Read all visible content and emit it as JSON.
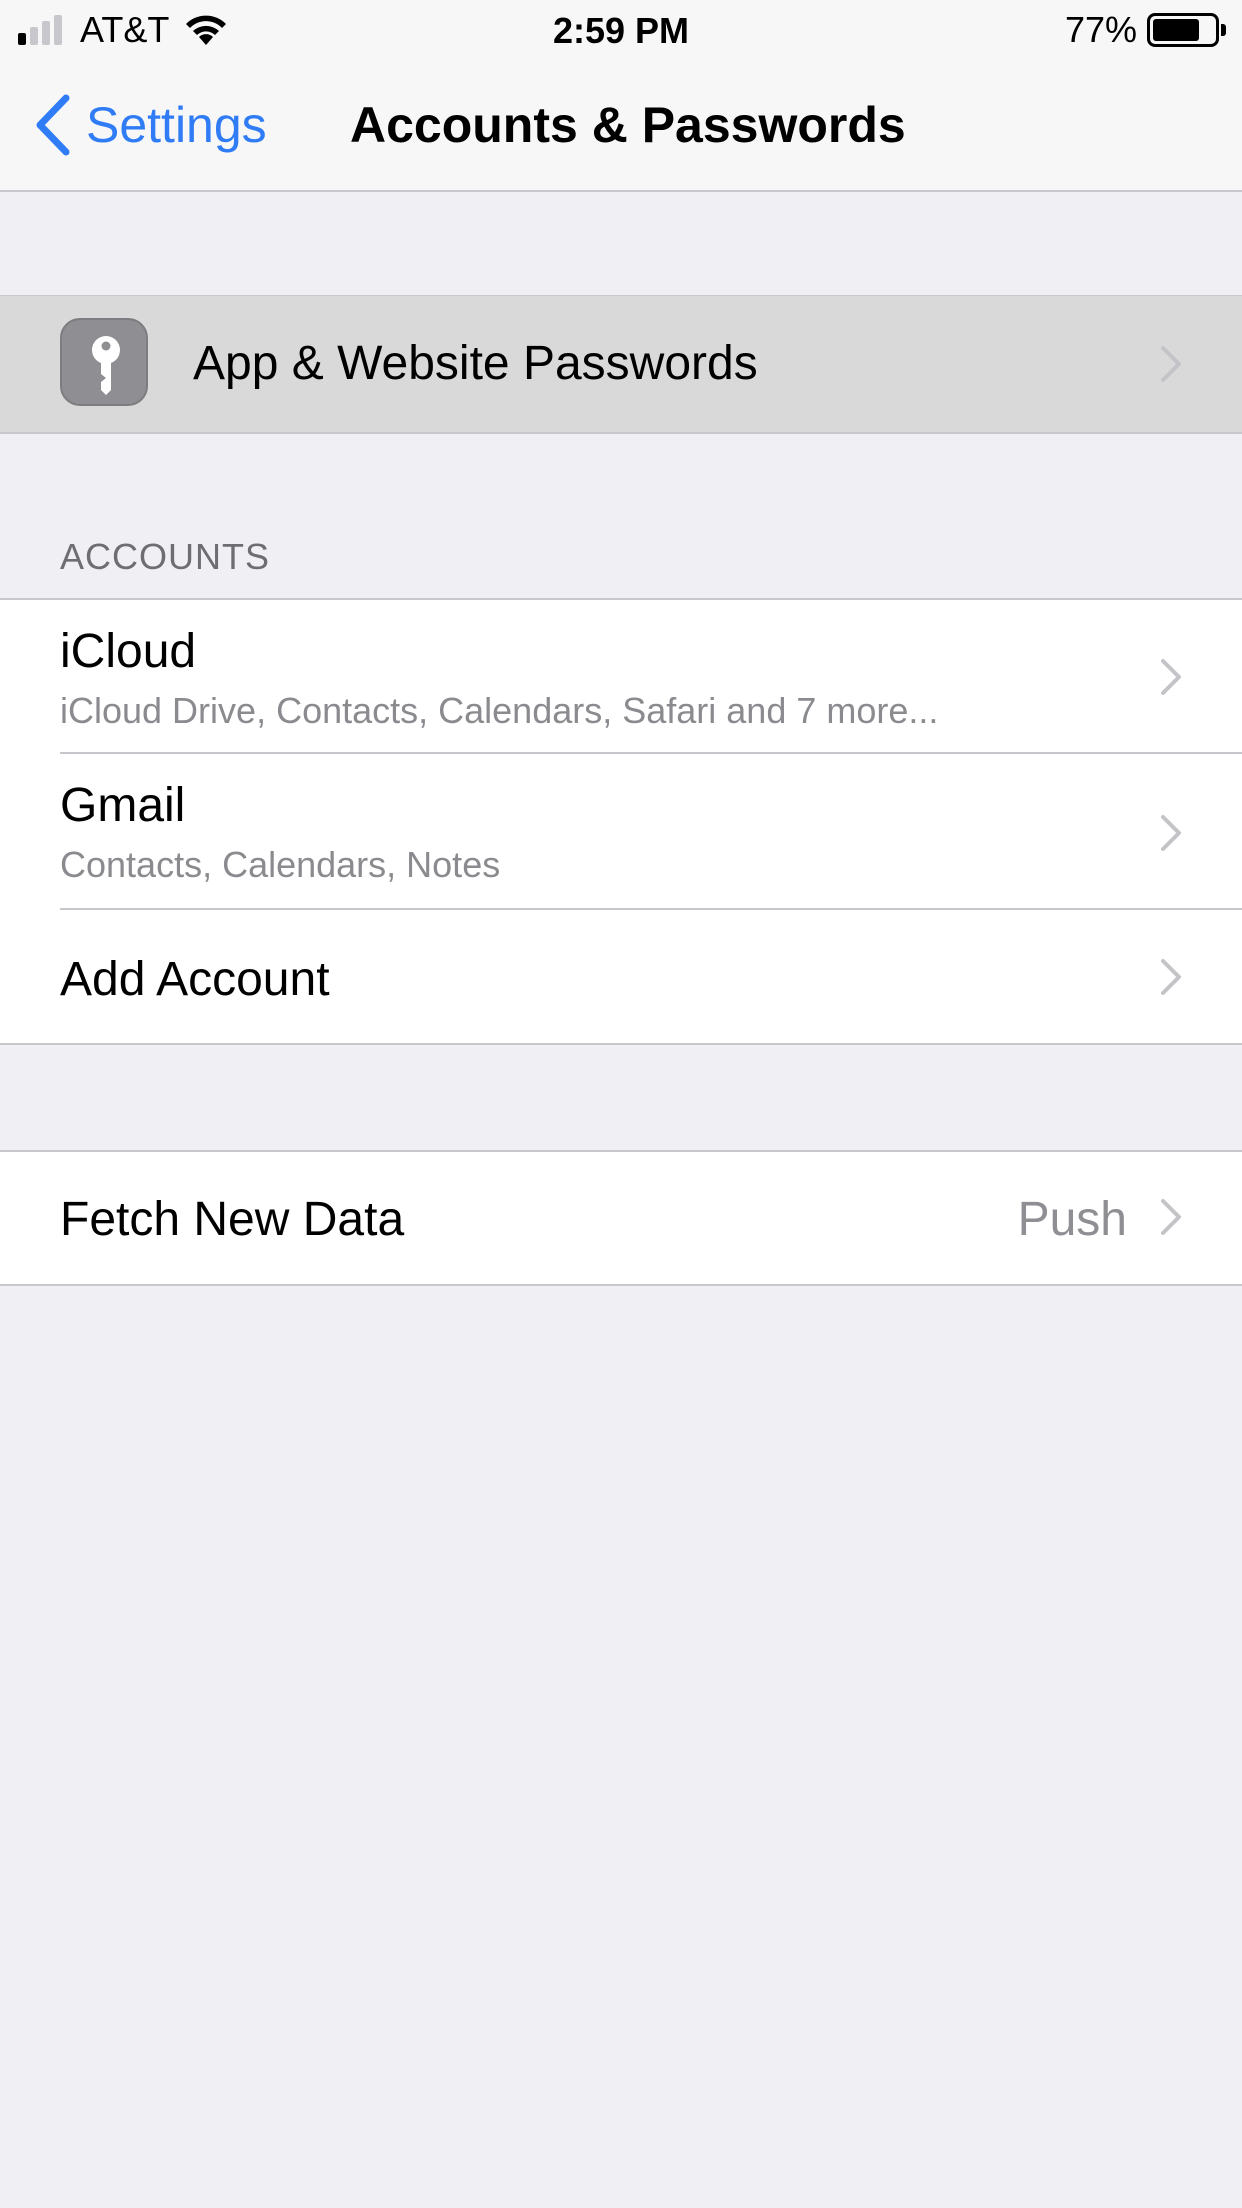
{
  "status_bar": {
    "carrier": "AT&T",
    "time": "2:59 PM",
    "battery_percent": "77%",
    "battery_level": 0.77,
    "signal_bars_active": 1,
    "signal_bars_total": 4
  },
  "nav": {
    "back_label": "Settings",
    "title": "Accounts & Passwords"
  },
  "passwords_row": {
    "label": "App & Website Passwords",
    "icon": "key-icon"
  },
  "accounts_section": {
    "header": "ACCOUNTS",
    "items": [
      {
        "title": "iCloud",
        "subtitle": "iCloud Drive, Contacts, Calendars, Safari and 7 more..."
      },
      {
        "title": "Gmail",
        "subtitle": "Contacts, Calendars, Notes"
      },
      {
        "title": "Add Account"
      }
    ]
  },
  "fetch_row": {
    "label": "Fetch New Data",
    "value": "Push"
  },
  "colors": {
    "accent": "#2f7cf6",
    "background": "#efeff4",
    "highlight": "#d9d9d9",
    "secondary_text": "#8a8a8f",
    "separator": "#c8c7cc"
  }
}
